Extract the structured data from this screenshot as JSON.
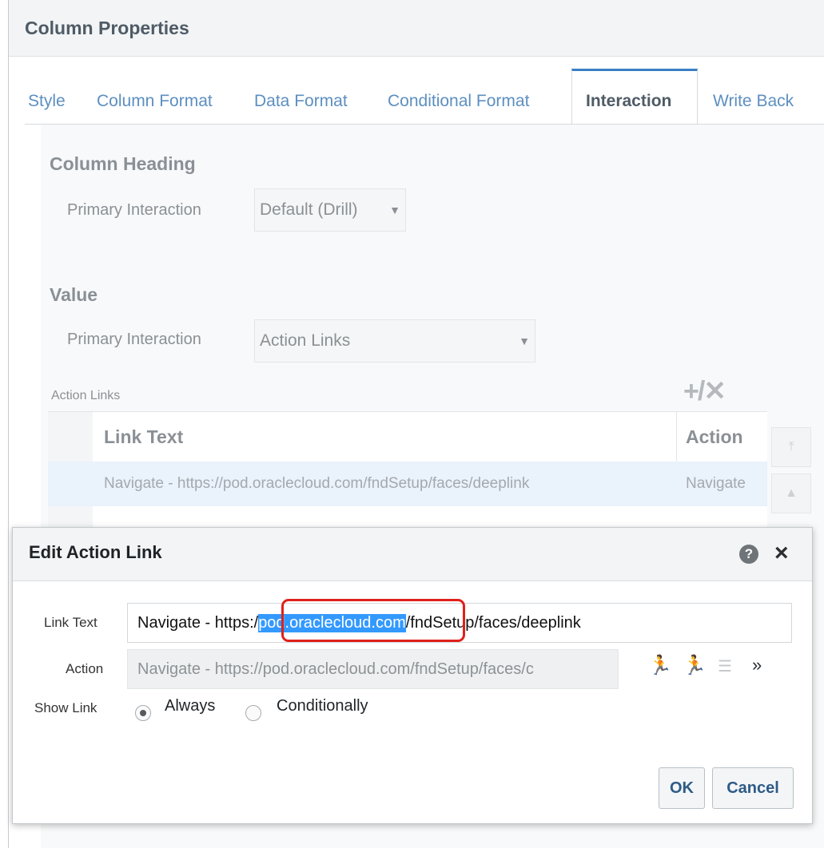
{
  "window": {
    "title": "Column Properties",
    "tabs": [
      {
        "label": "Style",
        "active": false
      },
      {
        "label": "Column Format",
        "active": false
      },
      {
        "label": "Data Format",
        "active": false
      },
      {
        "label": "Conditional Format",
        "active": false
      },
      {
        "label": "Interaction",
        "active": true
      },
      {
        "label": "Write Back",
        "active": false
      }
    ]
  },
  "column_heading": {
    "title": "Column Heading",
    "primary_interaction_label": "Primary Interaction",
    "primary_interaction_value": "Default (Drill)"
  },
  "value_section": {
    "title": "Value",
    "primary_interaction_label": "Primary Interaction",
    "primary_interaction_value": "Action Links"
  },
  "action_links": {
    "label": "Action Links",
    "toolbar": {
      "add": "+",
      "edit": "/",
      "delete": "✕"
    },
    "columns": [
      "Link Text",
      "Action"
    ],
    "rows": [
      {
        "link_text": "Navigate - https://pod.oraclecloud.com/fndSetup/faces/deeplink",
        "action": "Navigate"
      }
    ]
  },
  "dialog": {
    "title": "Edit Action Link",
    "link_text_label": "Link Text",
    "link_text_before": "Navigate - https:/",
    "link_text_selected": "pod.oraclecloud.com",
    "link_text_after": "/fndSetup/faces/deeplink",
    "action_label": "Action",
    "action_value": "Navigate - https://pod.oraclecloud.com/fndSetup/faces/c",
    "show_link_label": "Show Link",
    "show_link_options": [
      "Always",
      "Conditionally"
    ],
    "show_link_selected": "Always",
    "ok_label": "OK",
    "cancel_label": "Cancel"
  },
  "colors": {
    "accent": "#3a7fc4",
    "tab_link": "#5d8fc0",
    "selection": "#3399ff",
    "highlight_outline": "#e0201b"
  }
}
